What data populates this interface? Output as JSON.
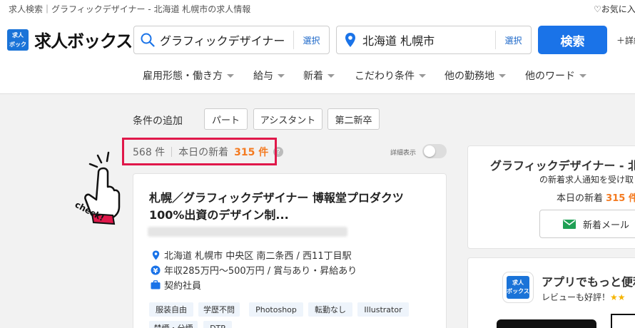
{
  "header": {
    "breadcrumb": "求人検索｜グラフィックデザイナー - 北海道 札幌市の求人情報",
    "favorites": "お気に入",
    "logo_text": "求人ボックス",
    "logo_mark": "求人\nボックス",
    "keyword": {
      "value": "グラフィックデザイナー",
      "select_label": "選択",
      "icon": "search-icon"
    },
    "location": {
      "value": "北海道 札幌市",
      "select_label": "選択",
      "icon": "location-pin-icon"
    },
    "search_button": "検索",
    "detail_link": "＋詳細",
    "nav": [
      "雇用形態・働き方",
      "給与",
      "新着",
      "こだわり条件",
      "他の勤務地",
      "他のワード"
    ]
  },
  "filters": {
    "label": "条件の追加",
    "chips": [
      "パート",
      "アシスタント",
      "第二新卒"
    ]
  },
  "results": {
    "count": "568 件",
    "new_today_label": "本日の新着",
    "new_today_count": "315 件",
    "help": "?",
    "detail_toggle_label": "詳細表示",
    "highlight_color": "#e0184a",
    "accent_color": "#f47a20"
  },
  "annotation": {
    "check_label": "check!"
  },
  "job_card": {
    "title": "札幌／グラフィックデザイナー 博報堂プロダクツ100%出資のデザイン制...",
    "location": "北海道 札幌市 中央区 南二条西 / 西11丁目駅",
    "salary": "年収285万円〜500万円 / 賞与あり・昇給あり",
    "employment": "契約社員",
    "tags": [
      "服装自由",
      "学歴不問",
      "Photoshop",
      "転勤なし",
      "Illustrator",
      "禁煙・分煙",
      "DTP"
    ]
  },
  "sidebar": {
    "notify": {
      "title": "グラフィックデザイナー - 北",
      "subtitle": "の新着求人通知を受け取",
      "new_label": "本日の新着",
      "new_count": "315 件",
      "mail_button": "新着メール",
      "mail_icon": "mail-icon"
    },
    "app": {
      "title": "アプリでもっと便利",
      "subtitle": "レビューも好評！",
      "stars": "★★",
      "icon_text": "求人\nボックス"
    }
  }
}
